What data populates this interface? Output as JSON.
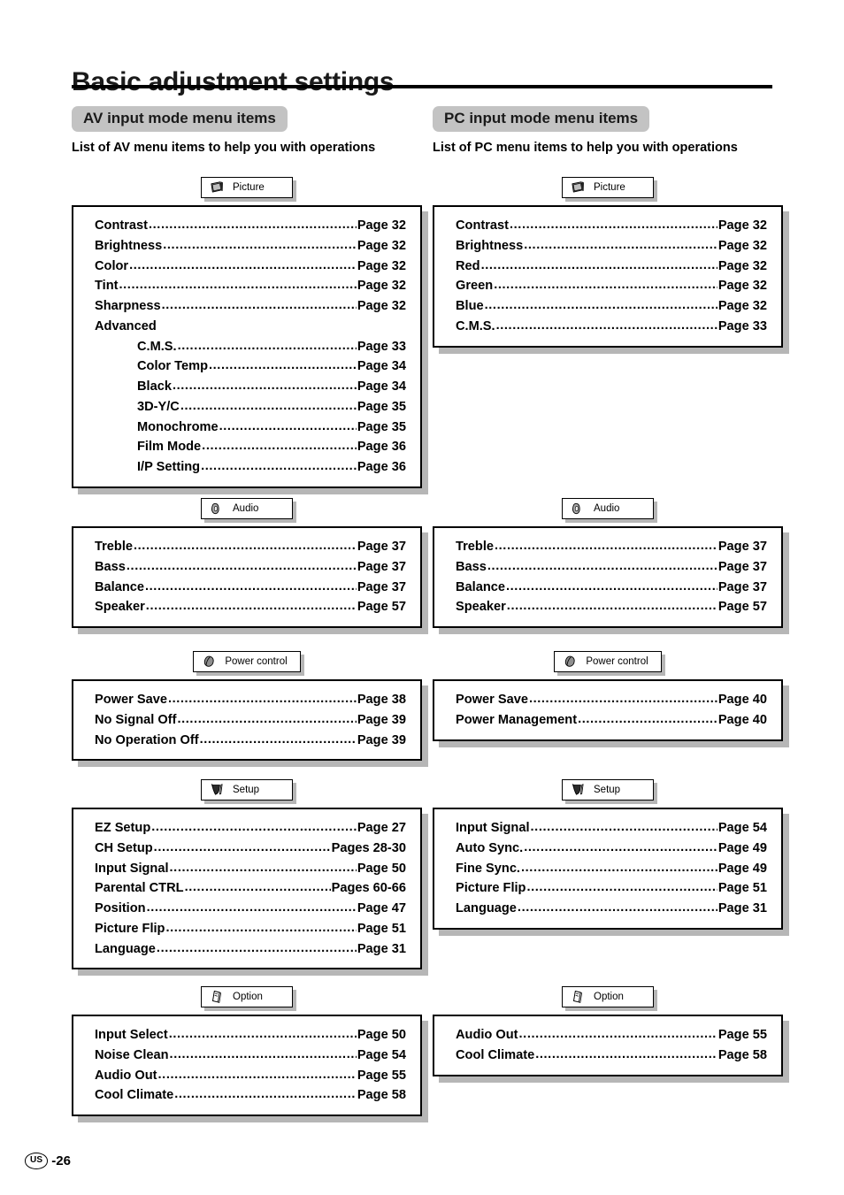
{
  "page": {
    "title": "Basic adjustment settings",
    "footer_region": "US",
    "footer_page": "-26"
  },
  "columns": [
    {
      "key": "av",
      "heading": "AV input mode menu items",
      "subheading": "List of AV menu items to help you with operations",
      "sections": [
        {
          "tab_label": "Picture",
          "tab_icon": "picture-icon",
          "entries": [
            {
              "name": "Contrast",
              "page": "Page 32",
              "indent": false
            },
            {
              "name": "Brightness",
              "page": "Page 32",
              "indent": false
            },
            {
              "name": "Color",
              "page": "Page 32",
              "indent": false
            },
            {
              "name": "Tint",
              "page": "Page 32",
              "indent": false
            },
            {
              "name": "Sharpness",
              "page": "Page 32",
              "indent": false
            },
            {
              "name": "Advanced",
              "page": "",
              "indent": false,
              "no_leader": true
            },
            {
              "name": "C.M.S.",
              "page": "Page 33",
              "indent": true
            },
            {
              "name": "Color Temp",
              "page": "Page 34",
              "indent": true
            },
            {
              "name": "Black",
              "page": "Page 34",
              "indent": true
            },
            {
              "name": "3D-Y/C",
              "page": "Page 35",
              "indent": true
            },
            {
              "name": "Monochrome",
              "page": "Page 35",
              "indent": true
            },
            {
              "name": "Film Mode",
              "page": "Page 36",
              "indent": true
            },
            {
              "name": "I/P Setting",
              "page": "Page 36",
              "indent": true
            }
          ]
        },
        {
          "tab_label": "Audio",
          "tab_icon": "audio-icon",
          "entries": [
            {
              "name": "Treble",
              "page": "Page 37",
              "indent": false
            },
            {
              "name": "Bass",
              "page": "Page 37",
              "indent": false
            },
            {
              "name": "Balance",
              "page": "Page 37",
              "indent": false
            },
            {
              "name": "Speaker",
              "page": "Page 57",
              "indent": false
            }
          ]
        },
        {
          "tab_label": "Power control",
          "tab_icon": "leaf-icon",
          "entries": [
            {
              "name": "Power Save",
              "page": "Page 38",
              "indent": false
            },
            {
              "name": "No Signal Off",
              "page": "Page 39",
              "indent": false
            },
            {
              "name": "No Operation Off",
              "page": "Page 39",
              "indent": false
            }
          ]
        },
        {
          "tab_label": "Setup",
          "tab_icon": "setup-icon",
          "entries": [
            {
              "name": "EZ Setup",
              "page": "Page 27",
              "indent": false
            },
            {
              "name": "CH Setup",
              "page": "Pages 28-30",
              "indent": false
            },
            {
              "name": "Input Signal",
              "page": "Page 50",
              "indent": false
            },
            {
              "name": "Parental CTRL",
              "page": "Pages 60-66",
              "indent": false
            },
            {
              "name": "Position",
              "page": "Page 47",
              "indent": false
            },
            {
              "name": "Picture Flip",
              "page": "Page 51",
              "indent": false
            },
            {
              "name": "Language",
              "page": "Page 31",
              "indent": false
            }
          ]
        },
        {
          "tab_label": "Option",
          "tab_icon": "option-icon",
          "entries": [
            {
              "name": "Input Select",
              "page": "Page 50",
              "indent": false
            },
            {
              "name": "Noise Clean",
              "page": "Page 54",
              "indent": false
            },
            {
              "name": "Audio Out",
              "page": "Page 55",
              "indent": false
            },
            {
              "name": "Cool Climate",
              "page": "Page 58",
              "indent": false
            }
          ]
        }
      ]
    },
    {
      "key": "pc",
      "heading": "PC input mode menu items",
      "subheading": "List of PC menu items to help you with operations",
      "sections": [
        {
          "tab_label": "Picture",
          "tab_icon": "picture-icon",
          "entries": [
            {
              "name": "Contrast",
              "page": "Page 32",
              "indent": false
            },
            {
              "name": "Brightness",
              "page": "Page 32",
              "indent": false
            },
            {
              "name": "Red",
              "page": "Page 32",
              "indent": false
            },
            {
              "name": "Green",
              "page": "Page 32",
              "indent": false
            },
            {
              "name": "Blue",
              "page": "Page 32",
              "indent": false
            },
            {
              "name": "C.M.S.",
              "page": "Page 33",
              "indent": false
            }
          ]
        },
        {
          "tab_label": "Audio",
          "tab_icon": "audio-icon",
          "entries": [
            {
              "name": "Treble",
              "page": "Page 37",
              "indent": false
            },
            {
              "name": "Bass",
              "page": "Page 37",
              "indent": false
            },
            {
              "name": "Balance",
              "page": "Page 37",
              "indent": false
            },
            {
              "name": "Speaker",
              "page": "Page 57",
              "indent": false
            }
          ]
        },
        {
          "tab_label": "Power control",
          "tab_icon": "leaf-icon",
          "entries": [
            {
              "name": "Power Save",
              "page": "Page 40",
              "indent": false
            },
            {
              "name": "Power Management",
              "page": "Page 40",
              "indent": false
            }
          ]
        },
        {
          "tab_label": "Setup",
          "tab_icon": "setup-icon",
          "entries": [
            {
              "name": "Input Signal",
              "page": "Page 54",
              "indent": false
            },
            {
              "name": "Auto Sync.",
              "page": "Page 49",
              "indent": false
            },
            {
              "name": "Fine Sync.",
              "page": "Page 49",
              "indent": false
            },
            {
              "name": "Picture Flip",
              "page": "Page 51",
              "indent": false
            },
            {
              "name": "Language",
              "page": "Page 31",
              "indent": false
            }
          ]
        },
        {
          "tab_label": "Option",
          "tab_icon": "option-icon",
          "entries": [
            {
              "name": "Audio Out",
              "page": "Page 55",
              "indent": false
            },
            {
              "name": "Cool Climate",
              "page": "Page 58",
              "indent": false
            }
          ]
        }
      ]
    }
  ],
  "section_offsets": {
    "av": [
      200,
      563,
      736,
      881,
      1115
    ],
    "pc": [
      200,
      563,
      736,
      881,
      1115
    ]
  },
  "colors": {
    "heading_background": "#c3c3c3",
    "shadow": "#b6b6b6",
    "border": "#000000",
    "text": "#000000"
  }
}
